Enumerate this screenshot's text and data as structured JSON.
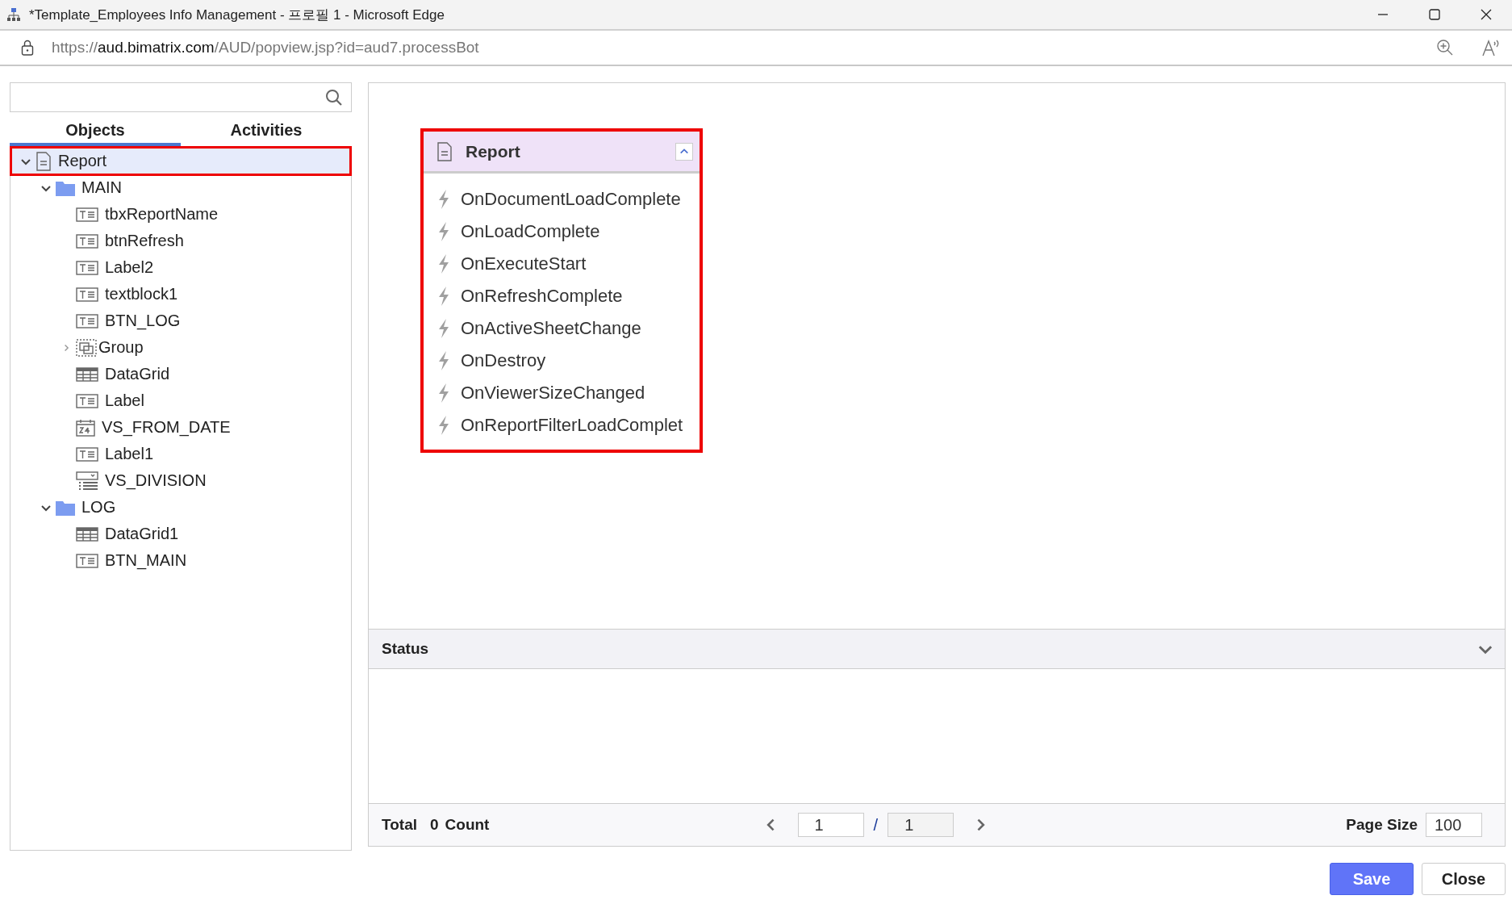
{
  "window": {
    "title": "*Template_Employees Info Management - 프로필 1 - Microsoft Edge"
  },
  "address_bar": {
    "scheme": "https://",
    "host": "aud.bimatrix.com",
    "path": "/AUD/popview.jsp?id=aud7.processBot"
  },
  "sidebar": {
    "tabs": [
      {
        "label": "Objects",
        "selected": true
      },
      {
        "label": "Activities",
        "selected": false
      }
    ],
    "tree": [
      {
        "label": "Report",
        "kind": "document",
        "expanded": true,
        "selected": true,
        "highlighted": true,
        "children": [
          {
            "label": "MAIN",
            "kind": "folder",
            "expanded": true,
            "selected": false,
            "highlighted": false,
            "children": [
              {
                "label": "tbxReportName",
                "kind": "text",
                "selected": false,
                "highlighted": false
              },
              {
                "label": "btnRefresh",
                "kind": "text",
                "selected": false,
                "highlighted": false
              },
              {
                "label": "Label2",
                "kind": "text",
                "selected": false,
                "highlighted": false
              },
              {
                "label": "textblock1",
                "kind": "text",
                "selected": false,
                "highlighted": false
              },
              {
                "label": "BTN_LOG",
                "kind": "text",
                "selected": false,
                "highlighted": false
              },
              {
                "label": "Group",
                "kind": "group",
                "expanded": false,
                "selected": false,
                "highlighted": false
              },
              {
                "label": "DataGrid",
                "kind": "grid",
                "selected": false,
                "highlighted": false
              },
              {
                "label": "Label",
                "kind": "text",
                "selected": false,
                "highlighted": false
              },
              {
                "label": "VS_FROM_DATE",
                "kind": "date",
                "selected": false,
                "highlighted": false
              },
              {
                "label": "Label1",
                "kind": "text",
                "selected": false,
                "highlighted": false
              },
              {
                "label": "VS_DIVISION",
                "kind": "combo",
                "selected": false,
                "highlighted": false
              }
            ]
          },
          {
            "label": "LOG",
            "kind": "folder",
            "expanded": true,
            "selected": false,
            "highlighted": false,
            "children": [
              {
                "label": "DataGrid1",
                "kind": "grid",
                "selected": false,
                "highlighted": false
              },
              {
                "label": "BTN_MAIN",
                "kind": "text",
                "selected": false,
                "highlighted": false
              }
            ]
          }
        ]
      }
    ]
  },
  "event_card": {
    "title": "Report",
    "highlighted": true,
    "expanded": true,
    "events": [
      "OnDocumentLoadComplete",
      "OnLoadComplete",
      "OnExecuteStart",
      "OnRefreshComplete",
      "OnActiveSheetChange",
      "OnDestroy",
      "OnViewerSizeChanged",
      "OnReportFilterLoadComplet"
    ]
  },
  "status": {
    "title": "Status",
    "expanded": false,
    "total_label": "Total",
    "count": "0",
    "count_label": "Count",
    "page": "1",
    "separator": "/",
    "page_count": "1",
    "page_size_label": "Page Size",
    "page_size": "100"
  },
  "buttons": [
    {
      "label": "Save",
      "kind": "primary"
    },
    {
      "label": "Close",
      "kind": "secondary"
    }
  ]
}
